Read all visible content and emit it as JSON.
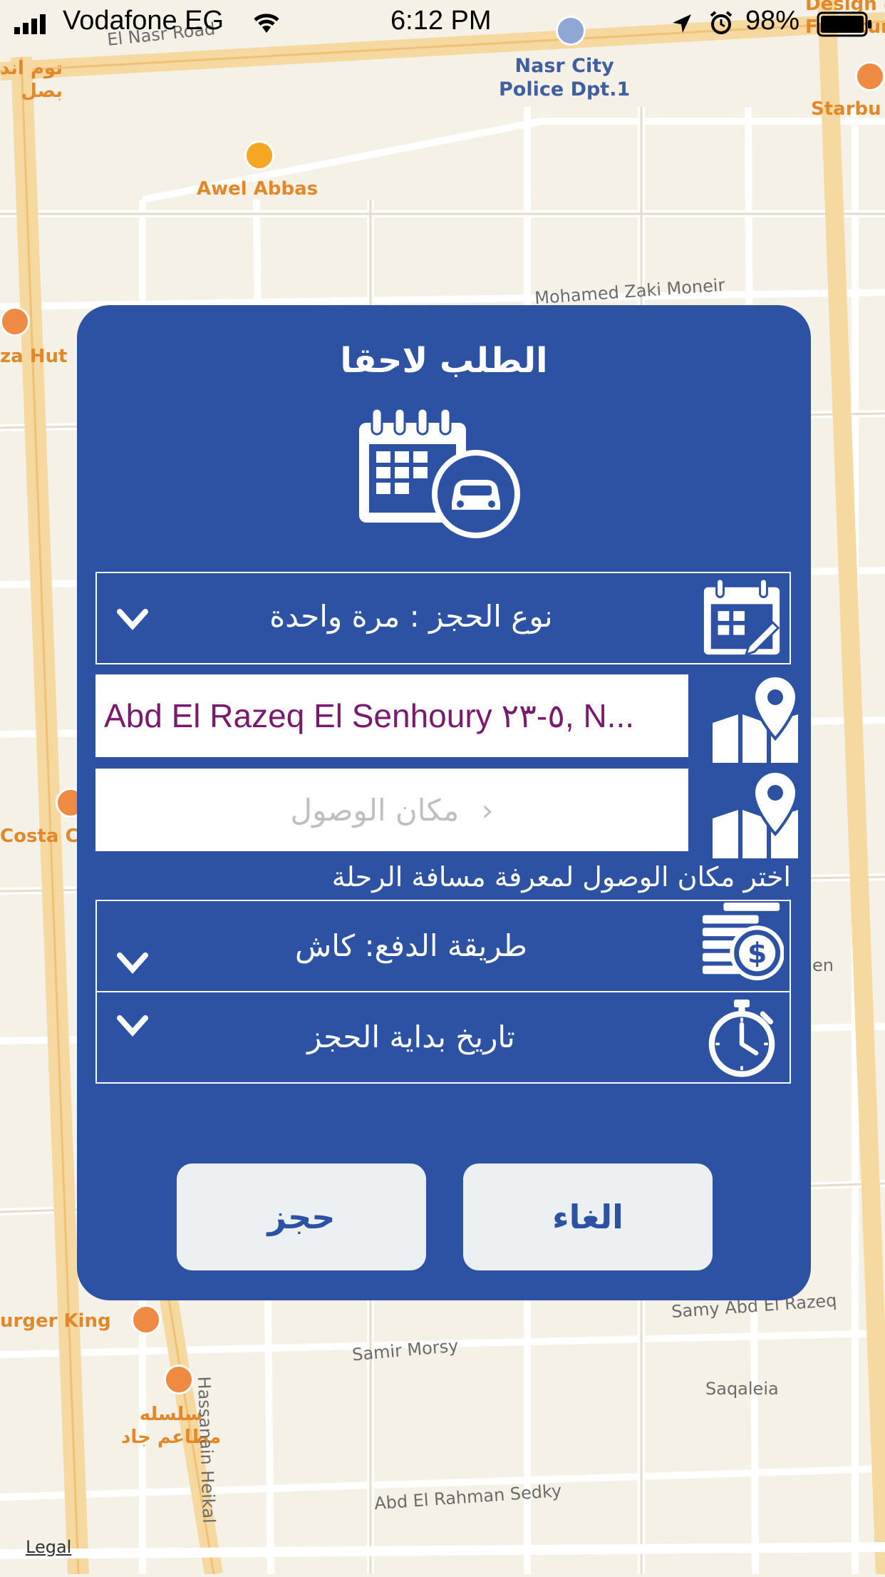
{
  "status_bar": {
    "carrier": "Vodafone EG",
    "time": "6:12 PM",
    "battery": "98%"
  },
  "map": {
    "labels": {
      "el_nasr_road": "El Nasr Road",
      "tom_and_basal": "توم اند\nبصل",
      "police": "Nasr City\nPolice Dpt.1",
      "design": "Design &\nFurniture",
      "starbucks": "Starbu",
      "awel_abbas": "Awel Abbas",
      "mohamed_zaki": "Mohamed Zaki Moneir",
      "pizza_hut": "za Hut",
      "costa": "Costa C",
      "burger_king": "urger King",
      "samy": "Samy Abd El Razeq",
      "samir": "Samir Morsy",
      "saqaleia": "Saqaleia",
      "selsela": "سلسله\nمطاعم جاد",
      "hassanain": "Hassanain Heikal",
      "abd_rahman": "Abd El Rahman Sedky",
      "legal": "Legal",
      "en": "en"
    }
  },
  "dialog": {
    "title": "الطلب لاحقا",
    "booking_type": "نوع الحجز : مرة واحدة",
    "pickup_value": "Abd El Razeq El Senhoury ٥-٢٣, N...",
    "dropoff_placeholder": "مكان الوصول",
    "dropoff_chevron": "›",
    "hint": "اختر مكان الوصول لمعرفة مسافة الرحلة",
    "payment_method": "طريقة الدفع:  كاش",
    "start_date": "تاريخ بداية الحجز",
    "cancel_label": "الغاء",
    "book_label": "حجز"
  },
  "colors": {
    "dialog_bg": "#2e52a3",
    "button_bg": "#edf0f2",
    "pickup_text": "#7a1a6e",
    "map_bg": "#f6f1e7"
  },
  "icons": {
    "hero": "calendar-car-icon",
    "booking_type": "calendar-edit-icon",
    "pickup": "map-pin-icon",
    "dropoff": "map-pin-icon",
    "payment": "coins-dollar-icon",
    "start_date": "stopwatch-icon",
    "chevron": "chevron-down-icon"
  }
}
